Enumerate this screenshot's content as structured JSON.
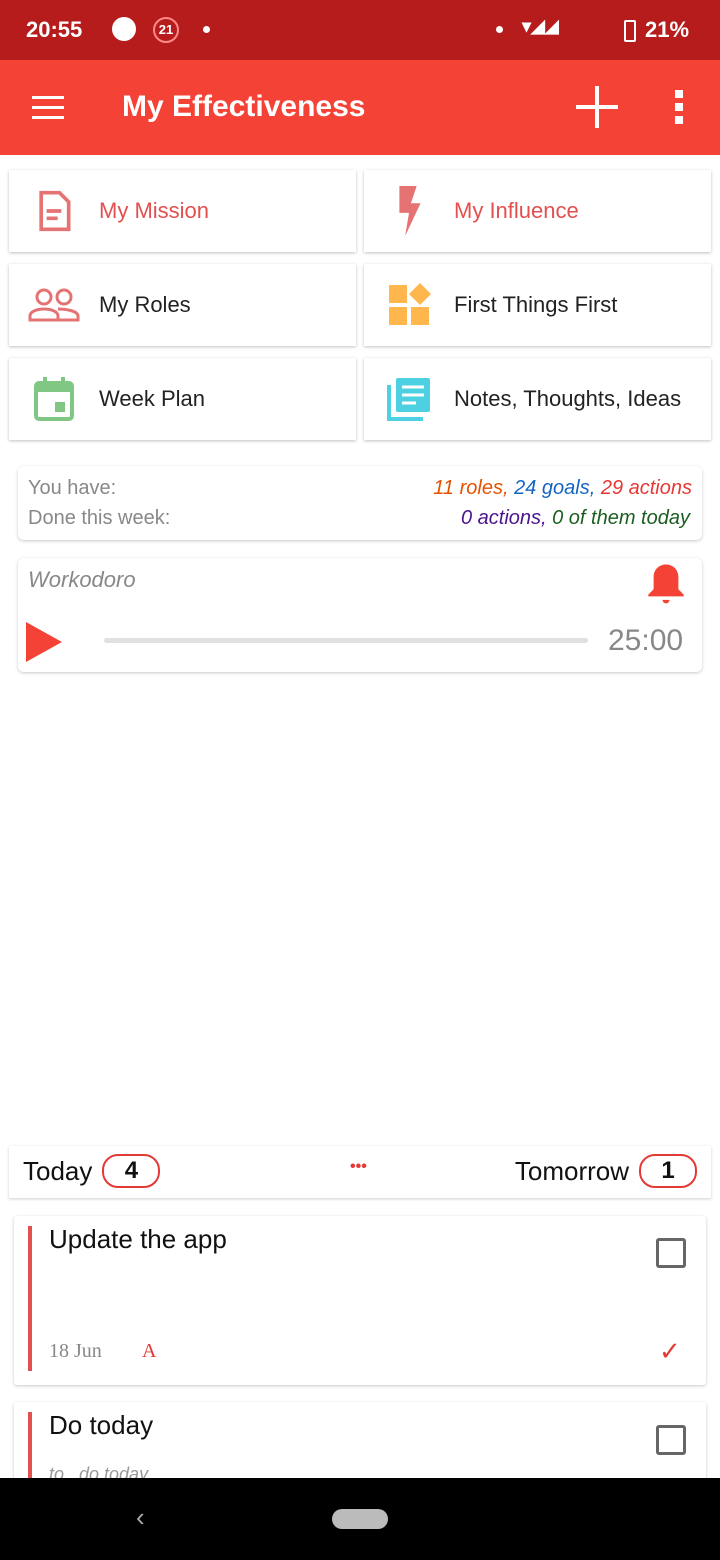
{
  "status_bar": {
    "time": "20:55",
    "notif_badge": "21",
    "battery": "21%"
  },
  "app_bar": {
    "title": "My Effectiveness"
  },
  "tiles": [
    {
      "label": "My Mission",
      "icon": "document-icon",
      "color": "#e57373"
    },
    {
      "label": "My Influence",
      "icon": "lightning-icon",
      "color": "#e57373"
    },
    {
      "label": "My Roles",
      "icon": "people-icon",
      "color": "#e57373"
    },
    {
      "label": "First Things First",
      "icon": "widgets-icon",
      "color": "#ffb74d"
    },
    {
      "label": "Week Plan",
      "icon": "calendar-icon",
      "color": "#81c784"
    },
    {
      "label": "Notes, Thoughts, Ideas",
      "icon": "notes-icon",
      "color": "#4dd0e1"
    }
  ],
  "stats": {
    "you_have_label": "You have:",
    "roles": "11 roles,",
    "goals": "24 goals,",
    "actions": "29 actions",
    "done_label": "Done this week:",
    "done_actions": "0 actions,",
    "done_today": "0 of them today"
  },
  "workodoro": {
    "title": "Workodoro",
    "time": "25:00",
    "progress": 0
  },
  "tabs": {
    "today_label": "Today",
    "today_count": "4",
    "tomorrow_label": "Tomorrow",
    "tomorrow_count": "1"
  },
  "tasks": [
    {
      "title": "Update the app",
      "date": "18 Jun",
      "priority": "A",
      "checked": false
    },
    {
      "title": "Do today",
      "subtitle": "to...do today",
      "checked": false
    }
  ]
}
